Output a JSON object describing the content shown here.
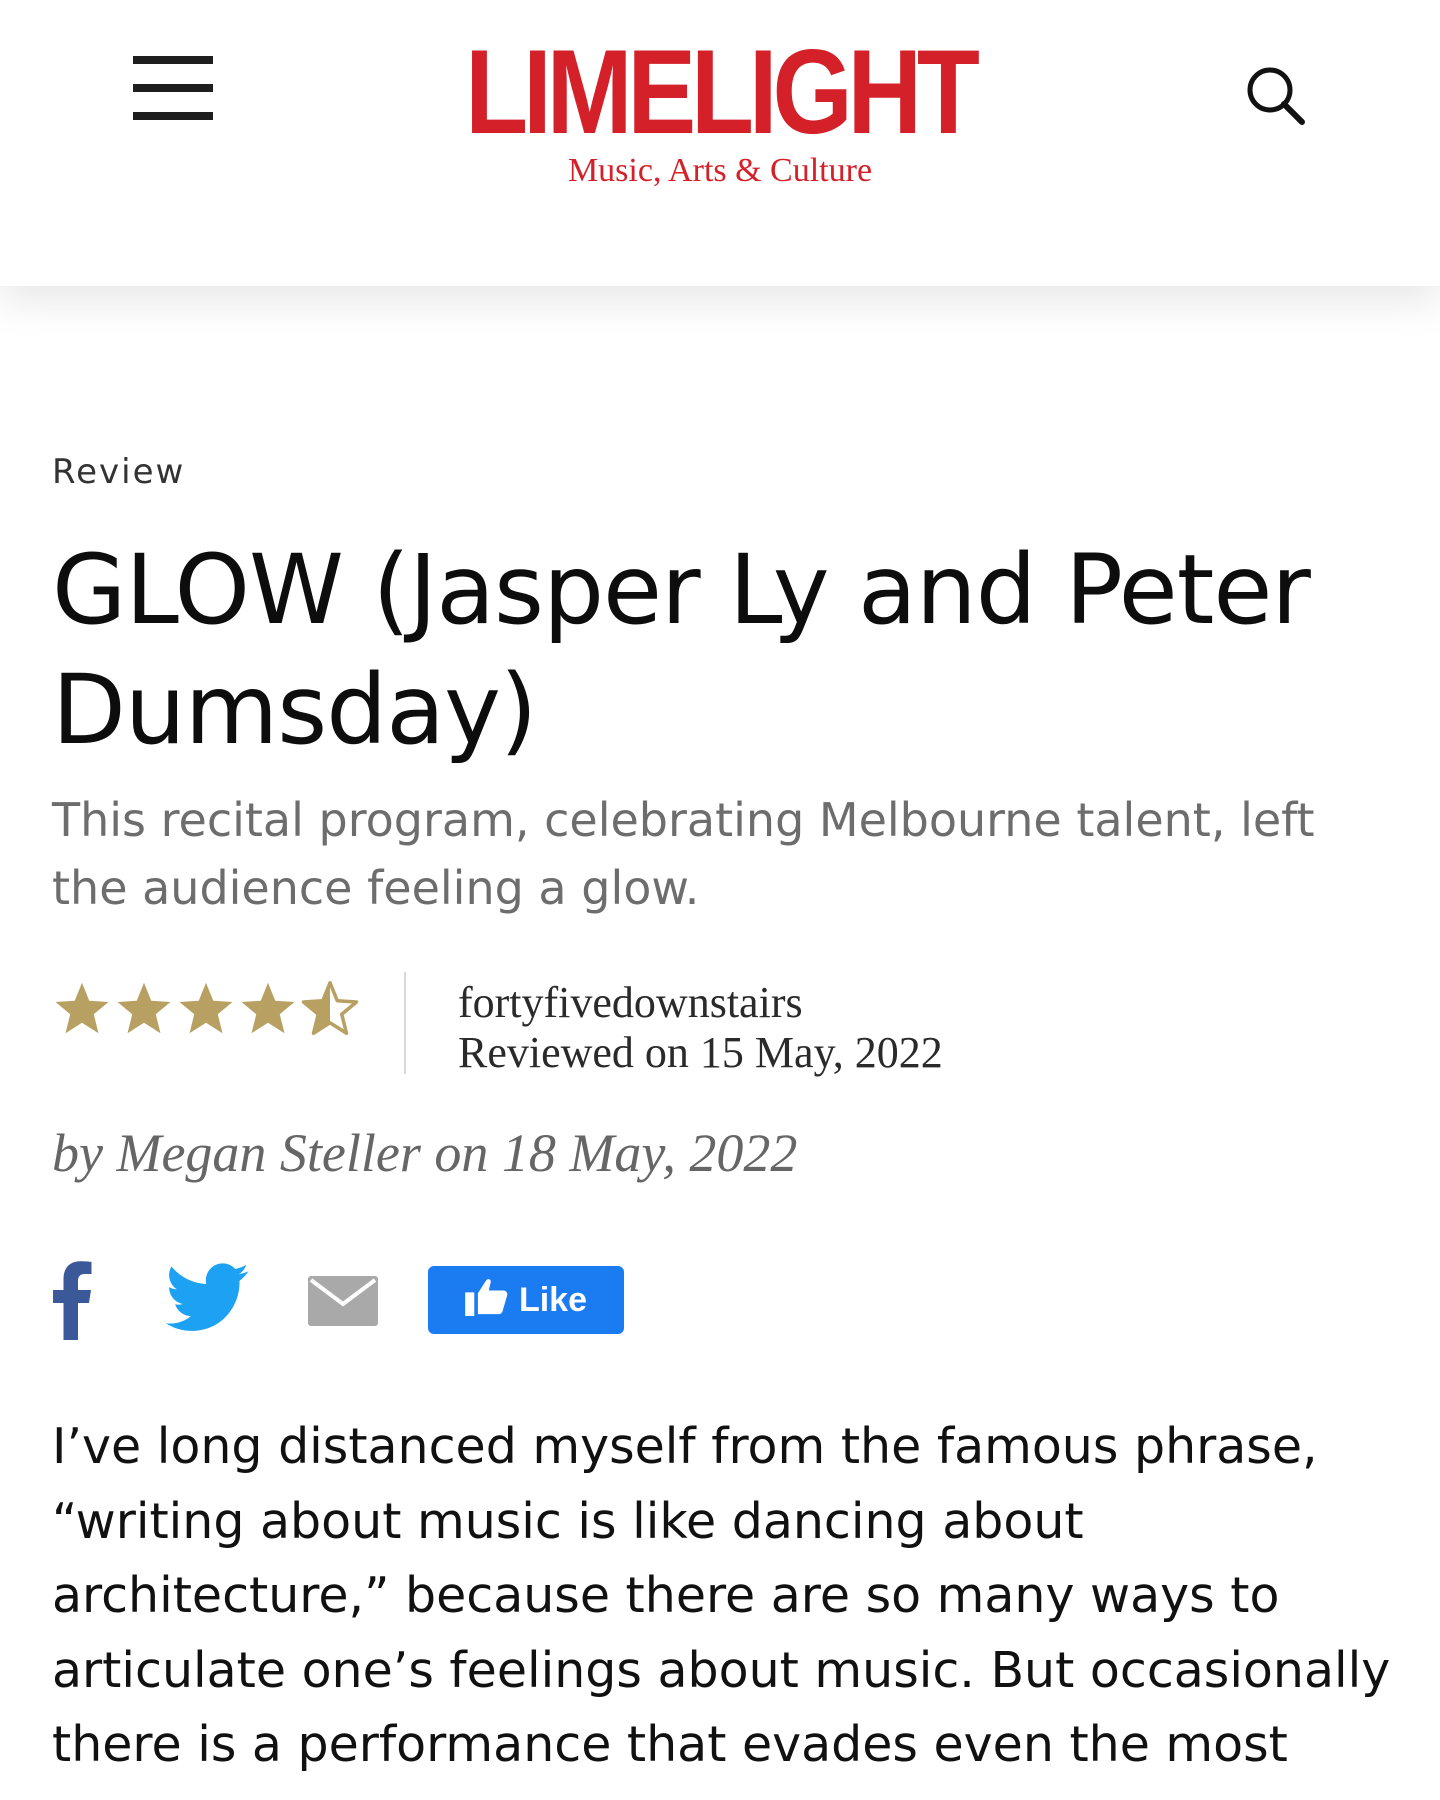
{
  "header": {
    "logo": "LIMELIGHT",
    "tagline": "Music, Arts & Culture",
    "menu_icon": "hamburger-menu-icon",
    "search_icon": "search-icon",
    "brand_color": "#d42029"
  },
  "article": {
    "category": "Review",
    "title": "GLOW (Jasper Ly and Peter Dumsday)",
    "standfirst": "This recital program, celebrating Melbourne talent, left the audience feeling a glow.",
    "rating": {
      "value": 4.5,
      "max": 5,
      "star_color": "#b8a062"
    },
    "venue": "fortyfivedownstairs",
    "reviewed_on": "Reviewed on 15 May, 2022",
    "byline": "by Megan Steller on 18 May, 2022",
    "share": {
      "facebook_icon": "facebook-icon",
      "twitter_icon": "twitter-icon",
      "email_icon": "email-icon",
      "like_label": "Like",
      "like_color": "#1b7cf2"
    },
    "body": "I’ve long distanced myself from the famous phrase, “writing about music is like dancing about architecture,” because there are so many ways to articulate one’s feelings about music. But occasionally there is a performance that evades even the most"
  }
}
